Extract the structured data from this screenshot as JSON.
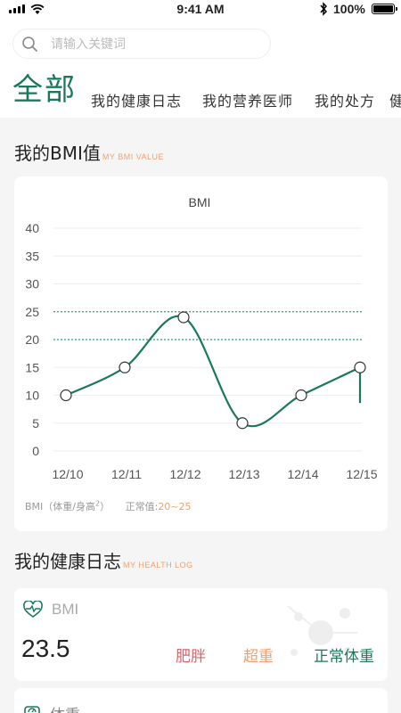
{
  "status_bar": {
    "time": "9:41 AM",
    "battery_percent": "100%",
    "battery_level": 1.0
  },
  "search": {
    "placeholder": "请输入关键词",
    "value": ""
  },
  "tabs": [
    {
      "label": "全部",
      "active": true
    },
    {
      "label": "我的健康日志",
      "active": false
    },
    {
      "label": "我的营养医师",
      "active": false
    },
    {
      "label": "我的处方",
      "active": false
    },
    {
      "label": "健",
      "active": false
    }
  ],
  "bmi_section": {
    "title": "我的BMI值",
    "subtitle": "MY BMI VALUE"
  },
  "chart_data": {
    "type": "line",
    "title": "BMI",
    "x": [
      "12/10",
      "12/11",
      "12/12",
      "12/13",
      "12/14",
      "12/15"
    ],
    "series": [
      {
        "values": [
          10,
          15,
          24,
          5,
          10,
          15
        ]
      }
    ],
    "ylim": [
      0,
      40
    ],
    "yticks": [
      0,
      5,
      10,
      15,
      20,
      25,
      30,
      35,
      40
    ],
    "reference_lines": [
      20,
      25
    ],
    "grid": true,
    "colors": {
      "line": "#1a7a58",
      "reference": "#2aa078",
      "grid": "#eeeeee"
    }
  },
  "chart_note": {
    "unit_label": "BMI（体重/身高",
    "unit_sup": "2",
    "unit_close": "）",
    "normal_label": "正常值:",
    "normal_range": "20~25"
  },
  "log_section": {
    "title": "我的健康日志",
    "subtitle": "MY HEALTH LOG"
  },
  "log_items": [
    {
      "icon": "heartbeat-icon",
      "label": "BMI",
      "value": "23.5",
      "statuses": {
        "fat": "肥胖",
        "over": "超重",
        "normal": "正常体重"
      }
    },
    {
      "icon": "scale-icon",
      "label": "体重"
    }
  ],
  "colors": {
    "accent": "#1a7a58",
    "orange": "#f0a070",
    "red": "#e0606a"
  }
}
